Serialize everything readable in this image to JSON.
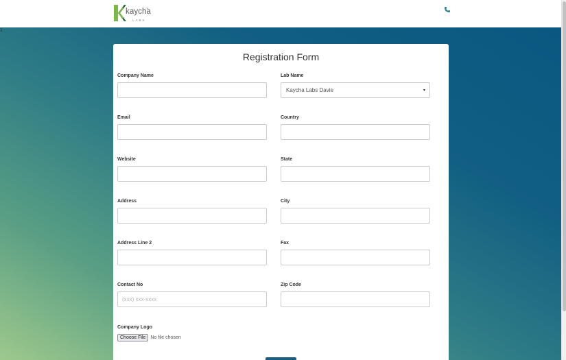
{
  "header": {
    "logo_word": "kaycha",
    "logo_tm": "™",
    "logo_sub": "LABS"
  },
  "page": {
    "marker": "1"
  },
  "form": {
    "title": "Registration Form",
    "fields": {
      "company_name": {
        "label": "Company Name",
        "value": ""
      },
      "lab_name": {
        "label": "Lab Name",
        "value": "Kaycha Labs Davie"
      },
      "email": {
        "label": "Email",
        "value": ""
      },
      "country": {
        "label": "Country",
        "value": ""
      },
      "website": {
        "label": "Website",
        "value": ""
      },
      "state": {
        "label": "State",
        "value": ""
      },
      "address": {
        "label": "Address",
        "value": ""
      },
      "city": {
        "label": "City",
        "value": ""
      },
      "address2": {
        "label": "Address Line 2",
        "value": ""
      },
      "fax": {
        "label": "Fax",
        "value": ""
      },
      "contact": {
        "label": "Contact No",
        "value": "",
        "placeholder": "(xxx) xxx-xxxx"
      },
      "zip": {
        "label": "Zip Code",
        "value": ""
      },
      "logo": {
        "label": "Company Logo",
        "button": "Choose File",
        "status": "No file chosen"
      }
    }
  },
  "colors": {
    "accent": "#1b5f83",
    "logo_green": "#7ab648",
    "logo_dark": "#2e6b3b"
  },
  "icons": {
    "phone": "phone-icon",
    "caret": "caret-down-icon"
  }
}
